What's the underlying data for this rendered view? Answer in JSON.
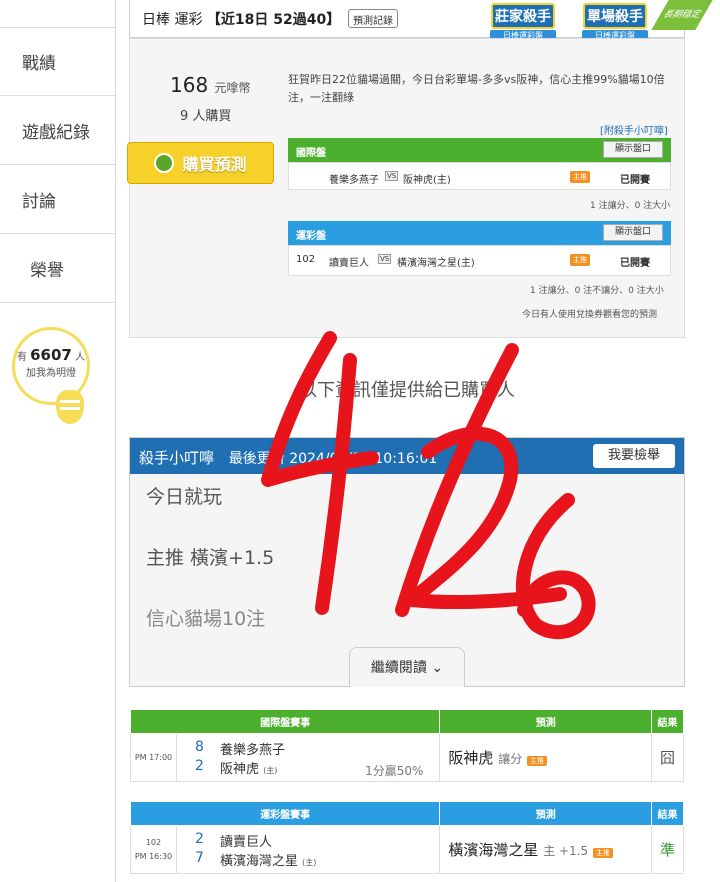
{
  "sidebar": {
    "items": [
      {
        "label": "戰績"
      },
      {
        "label": "遊戲紀錄"
      },
      {
        "label": "討論"
      },
      {
        "label": "榮譽"
      }
    ],
    "bulb": {
      "prefix": "有",
      "count": "6607",
      "suffix": "人",
      "line2": "加我為明燈"
    }
  },
  "topbar": {
    "title_prefix": "日棒 運彩",
    "title_bold": "【近18日 52過40】",
    "record_btn": "預測記錄",
    "badge1_big": "莊家殺手",
    "badge1_small": "日棒運彩盤",
    "badge2_big": "單場殺手",
    "badge2_small": "日棒運彩盤",
    "corner": "長期穩定"
  },
  "purchase": {
    "price": "168",
    "price_unit": "元嗱幣",
    "buyers": "9 人購買",
    "buy_btn": "購買預測",
    "description": "狂賀昨日22位貓場過關，今日台彩單場-多多vs阪神，信心主推99%貓場10倍注，一注翻綠",
    "tip_link": "[附殺手小叮嚀]"
  },
  "intl_panel": {
    "header": "國際盤",
    "show_btn": "顯示盤口",
    "away": "養樂多燕子",
    "vs": "VS",
    "home": "阪神虎(主)",
    "pick_tag": "主推",
    "status": "已開賽",
    "note": "1 注讓分、0 注大小"
  },
  "lottery_panel": {
    "header": "運彩盤",
    "show_btn": "顯示盤口",
    "code": "102",
    "away": "讀賣巨人",
    "vs": "VS",
    "home": "橫濱海灣之星(主)",
    "pick_tag": "主推",
    "status": "已開賽",
    "note": "1 注讓分、0 注不讓分、0 注大小",
    "note2": "今日有人使用兌換券觀看您的預測"
  },
  "only_buyers": "以下資訊僅提供給已購買人",
  "tip": {
    "title": "殺手小叮嚀",
    "updated": "最後更新 2024/04/26 10:16:01",
    "report_btn": "我要檢舉",
    "line1": "今日就玩",
    "line2": "主推 橫濱+1.5",
    "line3": "信心貓場10注",
    "continue_btn": "繼續閱讀"
  },
  "intl_table": {
    "headers": [
      "國際盤賽事",
      "預測",
      "結果"
    ],
    "time": "PM 17:00",
    "score_away": "8",
    "team_away": "養樂多燕子",
    "score_home": "2",
    "team_home": "阪神虎",
    "home_tag": "(主)",
    "pct": "1分贏50%",
    "pred_team": "阪神虎",
    "pred_sub": "讓分",
    "pred_tag": "主推",
    "result": "囧"
  },
  "lottery_table": {
    "headers": [
      "運彩盤賽事",
      "預測",
      "結果"
    ],
    "code": "102",
    "time": "PM 16:30",
    "score_away": "2",
    "team_away": "讀賣巨人",
    "score_home": "7",
    "team_home": "橫濱海灣之星",
    "home_tag": "(主)",
    "pred_team": "橫濱海灣之星",
    "pred_sub": "主 +1.5",
    "pred_tag": "主推",
    "result": "準"
  },
  "handwriting": {
    "text": "4/26",
    "color": "#e8141c"
  }
}
